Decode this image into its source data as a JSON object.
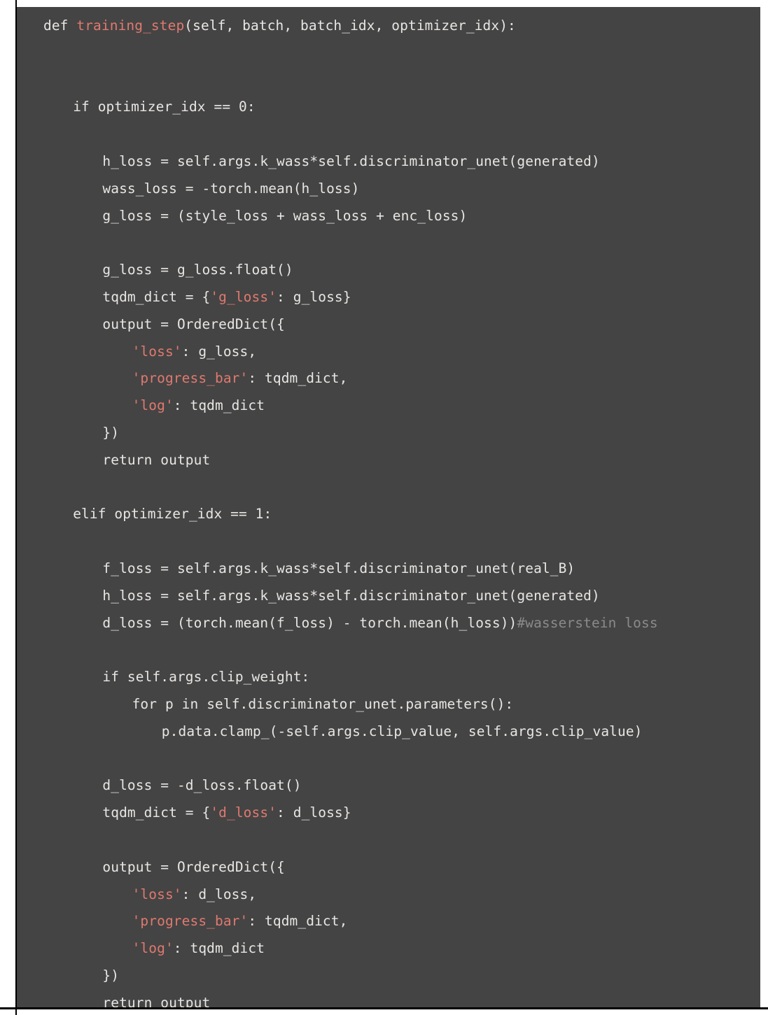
{
  "editor": {
    "language": "python",
    "background_color": "#444444",
    "default_text_color": "#e8e6e3",
    "string_color": "#e0796f",
    "function_name_color": "#e0796f",
    "comment_color": "#8a8a8a",
    "page_color": "#ffffff",
    "rule_color": "#000000"
  },
  "code": {
    "title": "training_step",
    "lines": [
      {
        "n": 1,
        "indent": 0,
        "tokens": [
          {
            "t": "kw",
            "s": "def "
          },
          {
            "t": "name",
            "s": "training_step"
          },
          {
            "t": "plain",
            "s": "(self, batch, batch_idx, optimizer_idx):"
          }
        ]
      },
      {
        "n": 2,
        "indent": 0,
        "tokens": []
      },
      {
        "n": 3,
        "indent": 0,
        "tokens": []
      },
      {
        "n": 4,
        "indent": 1,
        "tokens": [
          {
            "t": "kw",
            "s": "if "
          },
          {
            "t": "plain",
            "s": "optimizer_idx == "
          },
          {
            "t": "num",
            "s": "0"
          },
          {
            "t": "plain",
            "s": ":"
          }
        ]
      },
      {
        "n": 5,
        "indent": 0,
        "tokens": []
      },
      {
        "n": 6,
        "indent": 2,
        "tokens": [
          {
            "t": "plain",
            "s": "h_loss = self.args.k_wass*self.discriminator_unet(generated)"
          }
        ]
      },
      {
        "n": 7,
        "indent": 2,
        "tokens": [
          {
            "t": "plain",
            "s": "wass_loss = -torch.mean(h_loss)"
          }
        ]
      },
      {
        "n": 8,
        "indent": 2,
        "tokens": [
          {
            "t": "plain",
            "s": "g_loss = (style_loss + wass_loss + enc_loss)"
          }
        ]
      },
      {
        "n": 9,
        "indent": 0,
        "tokens": []
      },
      {
        "n": 10,
        "indent": 2,
        "tokens": [
          {
            "t": "plain",
            "s": "g_loss = g_loss.float()"
          }
        ]
      },
      {
        "n": 11,
        "indent": 2,
        "tokens": [
          {
            "t": "plain",
            "s": "tqdm_dict = {"
          },
          {
            "t": "str",
            "s": "'g_loss'"
          },
          {
            "t": "plain",
            "s": ": g_loss}"
          }
        ]
      },
      {
        "n": 12,
        "indent": 2,
        "tokens": [
          {
            "t": "plain",
            "s": "output = OrderedDict({"
          }
        ]
      },
      {
        "n": 13,
        "indent": 3,
        "tokens": [
          {
            "t": "str",
            "s": "'loss'"
          },
          {
            "t": "plain",
            "s": ": g_loss,"
          }
        ]
      },
      {
        "n": 14,
        "indent": 3,
        "tokens": [
          {
            "t": "str",
            "s": "'progress_bar'"
          },
          {
            "t": "plain",
            "s": ": tqdm_dict,"
          }
        ]
      },
      {
        "n": 15,
        "indent": 3,
        "tokens": [
          {
            "t": "str",
            "s": "'log'"
          },
          {
            "t": "plain",
            "s": ": tqdm_dict"
          }
        ]
      },
      {
        "n": 16,
        "indent": 2,
        "tokens": [
          {
            "t": "plain",
            "s": "})"
          }
        ]
      },
      {
        "n": 17,
        "indent": 2,
        "tokens": [
          {
            "t": "kw",
            "s": "return "
          },
          {
            "t": "plain",
            "s": "output"
          }
        ]
      },
      {
        "n": 18,
        "indent": 0,
        "tokens": []
      },
      {
        "n": 19,
        "indent": 1,
        "tokens": [
          {
            "t": "kw",
            "s": "elif "
          },
          {
            "t": "plain",
            "s": "optimizer_idx == "
          },
          {
            "t": "num",
            "s": "1"
          },
          {
            "t": "plain",
            "s": ":"
          }
        ]
      },
      {
        "n": 20,
        "indent": 0,
        "tokens": []
      },
      {
        "n": 21,
        "indent": 2,
        "tokens": [
          {
            "t": "plain",
            "s": "f_loss = self.args.k_wass*self.discriminator_unet(real_B)"
          }
        ]
      },
      {
        "n": 22,
        "indent": 2,
        "tokens": [
          {
            "t": "plain",
            "s": "h_loss = self.args.k_wass*self.discriminator_unet(generated)"
          }
        ]
      },
      {
        "n": 23,
        "indent": 2,
        "tokens": [
          {
            "t": "plain",
            "s": "d_loss = (torch.mean(f_loss) - torch.mean(h_loss))"
          },
          {
            "t": "comment",
            "s": "#wasserstein loss"
          }
        ]
      },
      {
        "n": 24,
        "indent": 0,
        "tokens": []
      },
      {
        "n": 25,
        "indent": 2,
        "tokens": [
          {
            "t": "kw",
            "s": "if "
          },
          {
            "t": "plain",
            "s": "self.args.clip_weight:"
          }
        ]
      },
      {
        "n": 26,
        "indent": 3,
        "tokens": [
          {
            "t": "kw",
            "s": "for "
          },
          {
            "t": "plain",
            "s": "p "
          },
          {
            "t": "kw",
            "s": "in "
          },
          {
            "t": "plain",
            "s": "self.discriminator_unet.parameters():"
          }
        ]
      },
      {
        "n": 27,
        "indent": 4,
        "tokens": [
          {
            "t": "plain",
            "s": "p.data.clamp_(-self.args.clip_value, self.args.clip_value)"
          }
        ]
      },
      {
        "n": 28,
        "indent": 0,
        "tokens": []
      },
      {
        "n": 29,
        "indent": 2,
        "tokens": [
          {
            "t": "plain",
            "s": "d_loss = -d_loss.float()"
          }
        ]
      },
      {
        "n": 30,
        "indent": 2,
        "tokens": [
          {
            "t": "plain",
            "s": "tqdm_dict = {"
          },
          {
            "t": "str",
            "s": "'d_loss'"
          },
          {
            "t": "plain",
            "s": ": d_loss}"
          }
        ]
      },
      {
        "n": 31,
        "indent": 0,
        "tokens": []
      },
      {
        "n": 32,
        "indent": 2,
        "tokens": [
          {
            "t": "plain",
            "s": "output = OrderedDict({"
          }
        ]
      },
      {
        "n": 33,
        "indent": 3,
        "tokens": [
          {
            "t": "str",
            "s": "'loss'"
          },
          {
            "t": "plain",
            "s": ": d_loss,"
          }
        ]
      },
      {
        "n": 34,
        "indent": 3,
        "tokens": [
          {
            "t": "str",
            "s": "'progress_bar'"
          },
          {
            "t": "plain",
            "s": ": tqdm_dict,"
          }
        ]
      },
      {
        "n": 35,
        "indent": 3,
        "tokens": [
          {
            "t": "str",
            "s": "'log'"
          },
          {
            "t": "plain",
            "s": ": tqdm_dict"
          }
        ]
      },
      {
        "n": 36,
        "indent": 2,
        "tokens": [
          {
            "t": "plain",
            "s": "})"
          }
        ]
      },
      {
        "n": 37,
        "indent": 2,
        "tokens": [
          {
            "t": "kw",
            "s": "return "
          },
          {
            "t": "plain",
            "s": "output"
          }
        ]
      }
    ],
    "plain_text": "def training_step(self, batch, batch_idx, optimizer_idx):\n\n\n    if optimizer_idx == 0:\n\n        h_loss = self.args.k_wass*self.discriminator_unet(generated)\n        wass_loss = -torch.mean(h_loss)\n        g_loss = (style_loss + wass_loss + enc_loss)\n\n        g_loss = g_loss.float()\n        tqdm_dict = {'g_loss': g_loss}\n        output = OrderedDict({\n            'loss': g_loss,\n            'progress_bar': tqdm_dict,\n            'log': tqdm_dict\n        })\n        return output\n\n    elif optimizer_idx == 1:\n\n        f_loss = self.args.k_wass*self.discriminator_unet(real_B)\n        h_loss = self.args.k_wass*self.discriminator_unet(generated)\n        d_loss = (torch.mean(f_loss) - torch.mean(h_loss))#wasserstein loss\n\n        if self.args.clip_weight:\n            for p in self.discriminator_unet.parameters():\n                p.data.clamp_(-self.args.clip_value, self.args.clip_value)\n\n        d_loss = -d_loss.float()\n        tqdm_dict = {'d_loss': d_loss}\n\n        output = OrderedDict({\n            'loss': d_loss,\n            'progress_bar': tqdm_dict,\n            'log': tqdm_dict\n        })\n        return output"
  }
}
